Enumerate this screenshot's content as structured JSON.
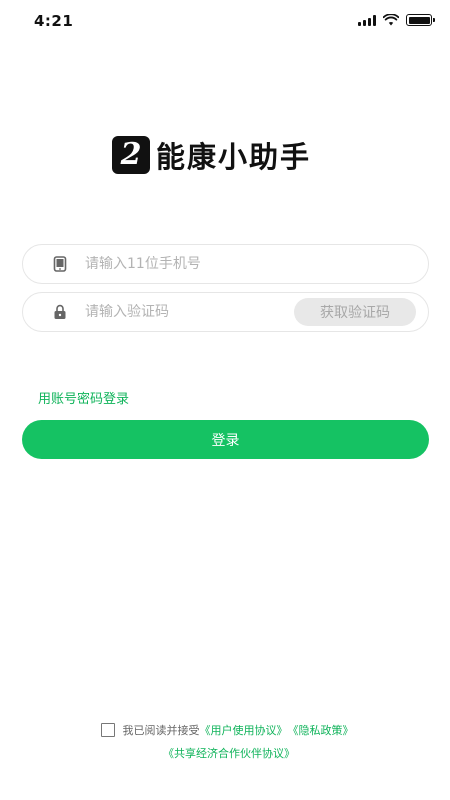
{
  "status_bar": {
    "time": "4:21"
  },
  "logo": {
    "mark": "2",
    "text": "能康小助手"
  },
  "phone_field": {
    "placeholder": "请输入11位手机号",
    "icon": "phone-icon"
  },
  "code_field": {
    "placeholder": "请输入验证码",
    "icon": "lock-icon",
    "get_code_label": "获取验证码"
  },
  "alt_login_label": "用账号密码登录",
  "login_label": "登录",
  "agreement": {
    "prefix": "我已阅读并接受",
    "user_agreement": "《用户使用协议》",
    "privacy_policy": "《隐私政策》",
    "partner_agreement": "《共享经济合作伙伴协议》",
    "checked": false
  },
  "colors": {
    "accent": "#15c263",
    "link": "#0fb35a",
    "disabled_button": "#e8e8e8"
  }
}
